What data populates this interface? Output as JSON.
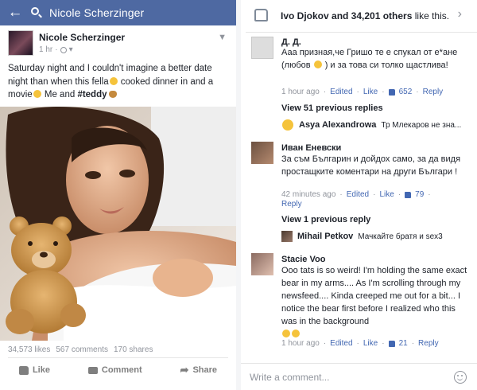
{
  "left": {
    "search_text": "Nicole Scherzinger",
    "post": {
      "author": "Nicole Scherzinger",
      "time": "1 hr",
      "text_1": "Saturday night and I couldn't imagine a better date night than when this fella",
      "text_2": " cooked dinner in and a movie",
      "text_3": " Me and ",
      "hashtag": "#teddy"
    },
    "stats": {
      "likes": "34,573 likes",
      "comments": "567 comments",
      "shares": "170 shares"
    },
    "actions": {
      "like": "Like",
      "comment": "Comment",
      "share": "Share"
    }
  },
  "right": {
    "likes_bar": {
      "names": "Ivo Djokov and 34,201 others",
      "suffix": " like this."
    },
    "comments": [
      {
        "name": "Д. Д.",
        "text_a": "Ааа призная,че Гришо те е спукал от е*ане (любов ",
        "text_b": " ) и за това си толко щастлива!",
        "time": "1 hour ago",
        "edited": "Edited",
        "like": "Like",
        "count": "652",
        "reply": "Reply"
      },
      {
        "name": "Иван Еневски",
        "text": "За съм Българин и дойдох само, за да видя простащките коментари на други Българи !",
        "time": "42 minutes ago",
        "edited": "Edited",
        "like": "Like",
        "count": "79",
        "reply": "Reply"
      },
      {
        "name": "Stacie Voo",
        "text": "Ooo tats is so weird! I'm holding the same exact bear in my arms.... As I'm scrolling through my newsfeed.... Kinda creeped me out for a bit... I notice the bear first before I realized who this was in the background",
        "time": "1 hour ago",
        "edited": "Edited",
        "like": "Like",
        "count": "21",
        "reply": "Reply"
      }
    ],
    "view_prev_1": "View 51 previous replies",
    "reply_1": {
      "name": "Asya Alexandrowa",
      "text": "Тр Млекаров не зна..."
    },
    "view_prev_2": "View 1 previous reply",
    "reply_2": {
      "name": "Mihail Petkov",
      "text": "Мачкайте братя и sex3"
    },
    "write_placeholder": "Write a comment..."
  },
  "colors": {
    "brand": "#4e69a2",
    "link": "#4267b2",
    "muted": "#90949c"
  }
}
